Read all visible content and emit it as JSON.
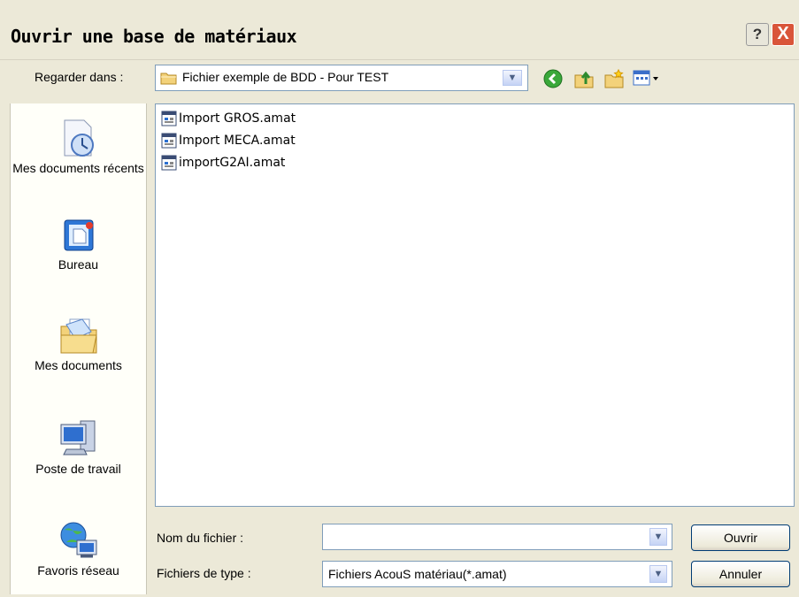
{
  "window": {
    "title": "Ouvrir une base de matériaux",
    "help_label": "?",
    "close_label": "X"
  },
  "toolbar": {
    "look_in_label": "Regarder dans :",
    "look_in_value": "Fichier exemple de BDD - Pour TEST",
    "icons": [
      "back-icon",
      "up-folder-icon",
      "new-folder-icon",
      "view-menu-icon"
    ]
  },
  "places": [
    {
      "name": "recent",
      "label": "Mes documents récents"
    },
    {
      "name": "desktop",
      "label": "Bureau"
    },
    {
      "name": "my-documents",
      "label": "Mes documents"
    },
    {
      "name": "my-computer",
      "label": "Poste de travail"
    },
    {
      "name": "network",
      "label": "Favoris réseau"
    }
  ],
  "files": [
    "Import GROS.amat",
    "Import MECA.amat",
    "importG2AI.amat"
  ],
  "filename": {
    "label": "Nom du fichier :",
    "value": ""
  },
  "filetype": {
    "label": "Fichiers de type :",
    "value": "Fichiers AcouS matériau(*.amat)"
  },
  "buttons": {
    "open": "Ouvrir",
    "cancel": "Annuler"
  },
  "colors": {
    "dialog_bg": "#ECE9D8",
    "places_bg": "#FFFFF9",
    "border": "#7F9DB9",
    "close": "#D9553A"
  }
}
